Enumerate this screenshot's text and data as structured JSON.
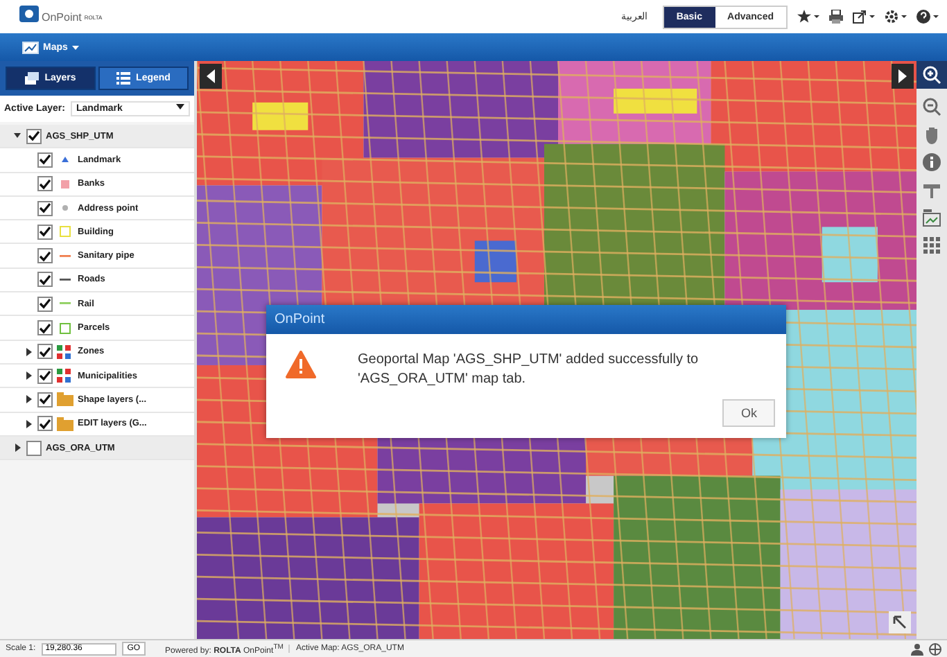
{
  "header": {
    "logo_text": "OnPoint",
    "logo_sub": "ROLTA",
    "language": "العربية",
    "modes": [
      {
        "label": "Basic",
        "selected": true
      },
      {
        "label": "Advanced",
        "selected": false
      }
    ]
  },
  "menubar": {
    "menu": "Maps"
  },
  "panel": {
    "tabs": [
      {
        "label": "Layers",
        "selected": true
      },
      {
        "label": "Legend",
        "selected": false
      }
    ],
    "active_layer_label": "Active Layer:",
    "active_layer": "Landmark",
    "tree": [
      {
        "label": "AGS_SHP_UTM",
        "checked": true,
        "expanded": true,
        "children": [
          {
            "label": "Landmark",
            "checked": true,
            "kind": "triangle",
            "color": "#3a6fd8"
          },
          {
            "label": "Banks",
            "checked": true,
            "kind": "square",
            "color": "#f2a0a8"
          },
          {
            "label": "Address point",
            "checked": true,
            "kind": "dot",
            "color": "#b0b0b0"
          },
          {
            "label": "Building",
            "checked": true,
            "kind": "outline",
            "color": "#e8e040"
          },
          {
            "label": "Sanitary pipe",
            "checked": true,
            "kind": "line",
            "color": "#f08050"
          },
          {
            "label": "Roads",
            "checked": true,
            "kind": "line",
            "color": "#555555"
          },
          {
            "label": "Rail",
            "checked": true,
            "kind": "line",
            "color": "#90d060"
          },
          {
            "label": "Parcels",
            "checked": true,
            "kind": "outline",
            "color": "#70c040"
          },
          {
            "label": "Zones",
            "checked": true,
            "expanded": false,
            "kind": "multi",
            "color": "#2a9a40"
          },
          {
            "label": "Municipalities",
            "checked": true,
            "expanded": false,
            "kind": "multi",
            "color": "#2a9a40"
          },
          {
            "label": "Shape layers (...",
            "checked": true,
            "expanded": false,
            "kind": "folder",
            "color": "#e0a030"
          },
          {
            "label": "EDIT layers (G...",
            "checked": true,
            "expanded": false,
            "kind": "folder",
            "color": "#e0a030"
          }
        ]
      },
      {
        "label": "AGS_ORA_UTM",
        "checked": false,
        "expanded": false
      }
    ]
  },
  "dialog": {
    "title": "OnPoint",
    "message": "Geoportal Map 'AGS_SHP_UTM' added successfully to 'AGS_ORA_UTM' map tab.",
    "button": "Ok"
  },
  "status_bar": {
    "scale_label": "Scale 1:",
    "scale_value": "19,280.36",
    "go": "GO",
    "powered": "Powered by: **ROLTA** OnPoint$^{TM}$",
    "active_map": "Active Map: AGS_ORA_UTM"
  }
}
